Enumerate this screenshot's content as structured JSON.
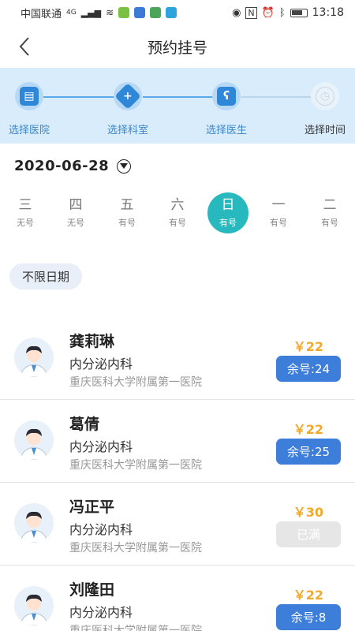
{
  "status_bar": {
    "carrier": "中国联通",
    "network": "4G",
    "time": "13:18"
  },
  "header": {
    "title": "预约挂号"
  },
  "steps": [
    {
      "label": "选择医院",
      "icon": "hospital-icon",
      "done": true
    },
    {
      "label": "选择科室",
      "icon": "department-icon",
      "done": true
    },
    {
      "label": "选择医生",
      "icon": "stethoscope-icon",
      "done": true
    },
    {
      "label": "选择时间",
      "icon": "clock-icon",
      "done": false
    }
  ],
  "date_selector": {
    "date": "2020-06-28"
  },
  "week": [
    {
      "day": "三",
      "availability": "无号",
      "selected": false
    },
    {
      "day": "四",
      "availability": "无号",
      "selected": false
    },
    {
      "day": "五",
      "availability": "有号",
      "selected": false
    },
    {
      "day": "六",
      "availability": "有号",
      "selected": false
    },
    {
      "day": "日",
      "availability": "有号",
      "selected": true
    },
    {
      "day": "一",
      "availability": "有号",
      "selected": false
    },
    {
      "day": "二",
      "availability": "有号",
      "selected": false
    }
  ],
  "filter": {
    "label": "不限日期"
  },
  "doctors": [
    {
      "name": "龚莉琳",
      "department": "内分泌内科",
      "hospital": "重庆医科大学附属第一医院",
      "price": "￥22",
      "slots": "余号:24",
      "full": false
    },
    {
      "name": "葛倩",
      "department": "内分泌内科",
      "hospital": "重庆医科大学附属第一医院",
      "price": "￥22",
      "slots": "余号:25",
      "full": false
    },
    {
      "name": "冯正平",
      "department": "内分泌内科",
      "hospital": "重庆医科大学附属第一医院",
      "price": "￥30",
      "slots": "已满",
      "full": true
    },
    {
      "name": "刘隆田",
      "department": "内分泌内科",
      "hospital": "重庆医科大学附属第一医院",
      "price": "￥22",
      "slots": "余号:8",
      "full": false
    }
  ],
  "colors": {
    "accent_teal": "#27b9bd",
    "button_blue": "#3c7ed9",
    "price_orange": "#f0a92b",
    "steps_bg": "#d9ecfb"
  }
}
